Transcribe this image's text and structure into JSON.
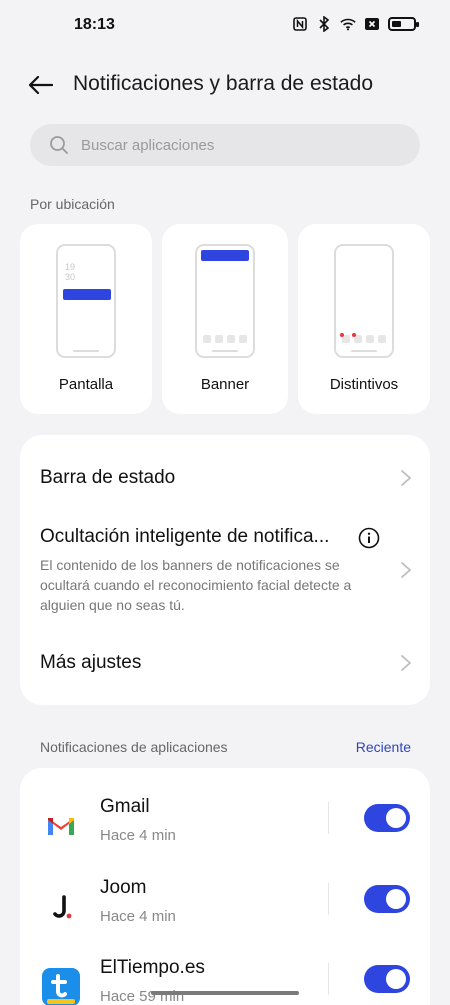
{
  "status_bar": {
    "time": "18:13",
    "icons": [
      "nfc-icon",
      "bluetooth-icon",
      "wifi-icon",
      "sim-disabled-icon",
      "battery-icon"
    ],
    "battery_level": 0.45
  },
  "header": {
    "title": "Notificaciones y barra de estado"
  },
  "search": {
    "placeholder": "Buscar aplicaciones",
    "value": ""
  },
  "location": {
    "section_label": "Por ubicación",
    "options": [
      {
        "label": "Pantalla",
        "clock_line1": "19",
        "clock_line2": "30"
      },
      {
        "label": "Banner"
      },
      {
        "label": "Distintivos"
      }
    ]
  },
  "settings": {
    "items": [
      {
        "title": "Barra de estado"
      },
      {
        "title": "Ocultación inteligente de notifica...",
        "description": "El contenido de los banners de notificaciones se ocultará cuando el reconocimiento facial detecte a alguien que no seas tú."
      },
      {
        "title": "Más ajustes"
      }
    ]
  },
  "app_notifications": {
    "section_label": "Notificaciones de aplicaciones",
    "sort_label": "Reciente",
    "apps": [
      {
        "name": "Gmail",
        "time": "Hace 4 min",
        "enabled": true,
        "icon": "gmail-icon"
      },
      {
        "name": "Joom",
        "time": "Hace 4 min",
        "enabled": true,
        "icon": "joom-icon"
      },
      {
        "name": "ElTiempo.es",
        "time": "Hace 59 min",
        "enabled": true,
        "icon": "eltiempo-icon"
      }
    ]
  },
  "colors": {
    "accent": "#2e45e0",
    "background": "#f3f3f5",
    "card": "#ffffff"
  }
}
